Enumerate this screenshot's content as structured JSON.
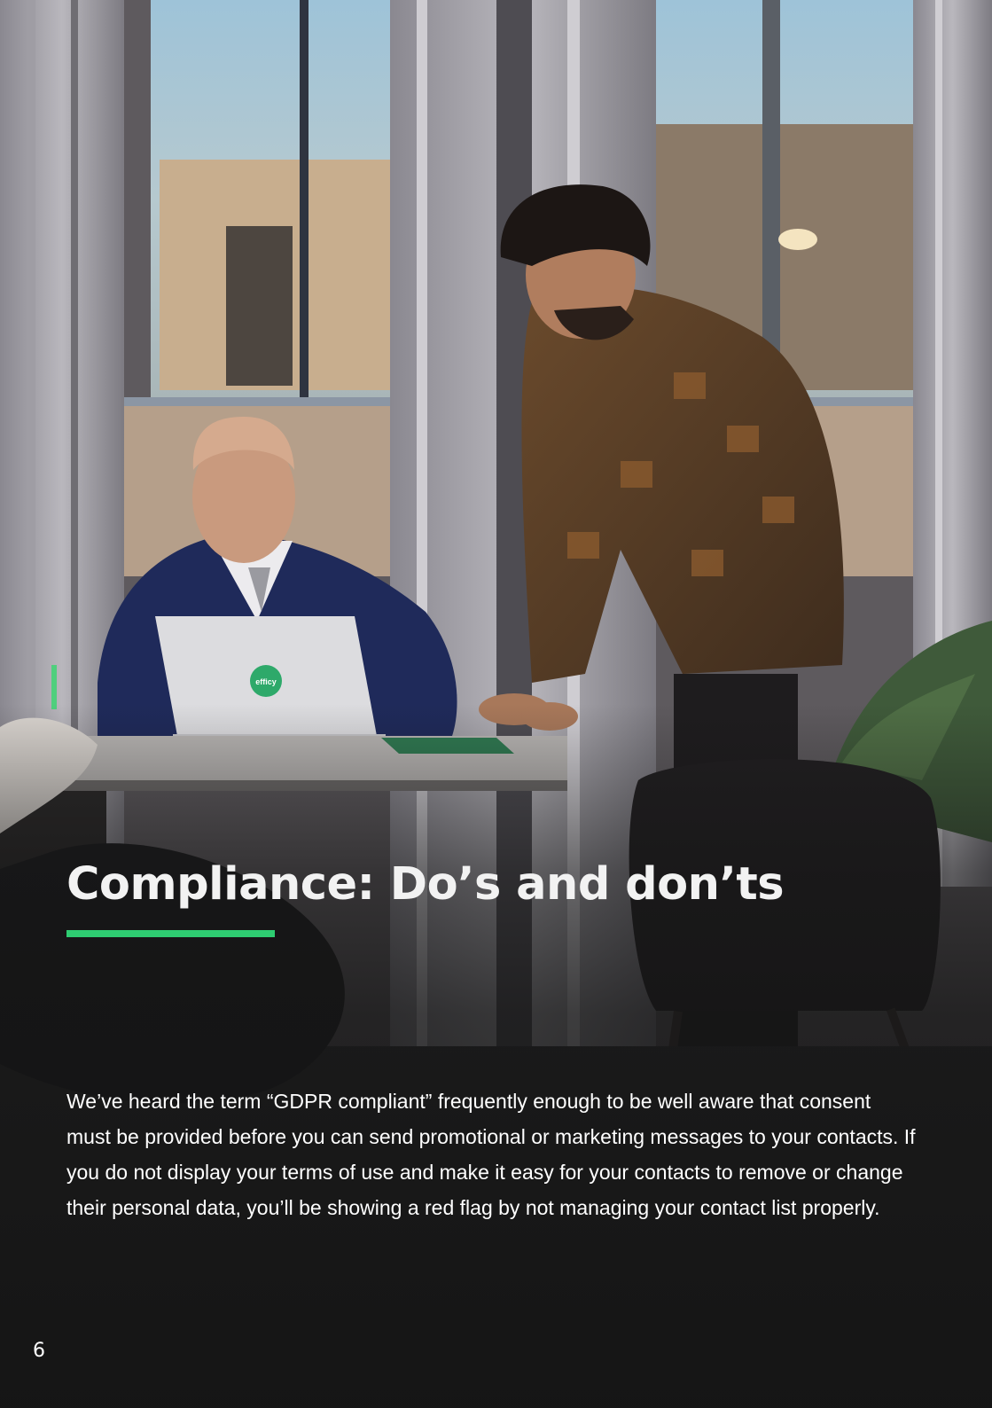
{
  "page": {
    "title": "Compliance: Do’s and don’ts",
    "body": "We’ve heard the term “GDPR compliant” frequently enough to be well aware that consent must be provided before you can send promotional or marketing messages to your contacts. If you do not display your terms of use and make it easy for your contacts to remove or change their personal data, you’ll be showing a red flag by not managing your contact list properly.",
    "page_number": "6",
    "laptop_logo": "efficy"
  },
  "colors": {
    "accent": "#2ecc71",
    "title": "#f2f2f2",
    "text": "#ffffff",
    "overlay": "#141414"
  }
}
